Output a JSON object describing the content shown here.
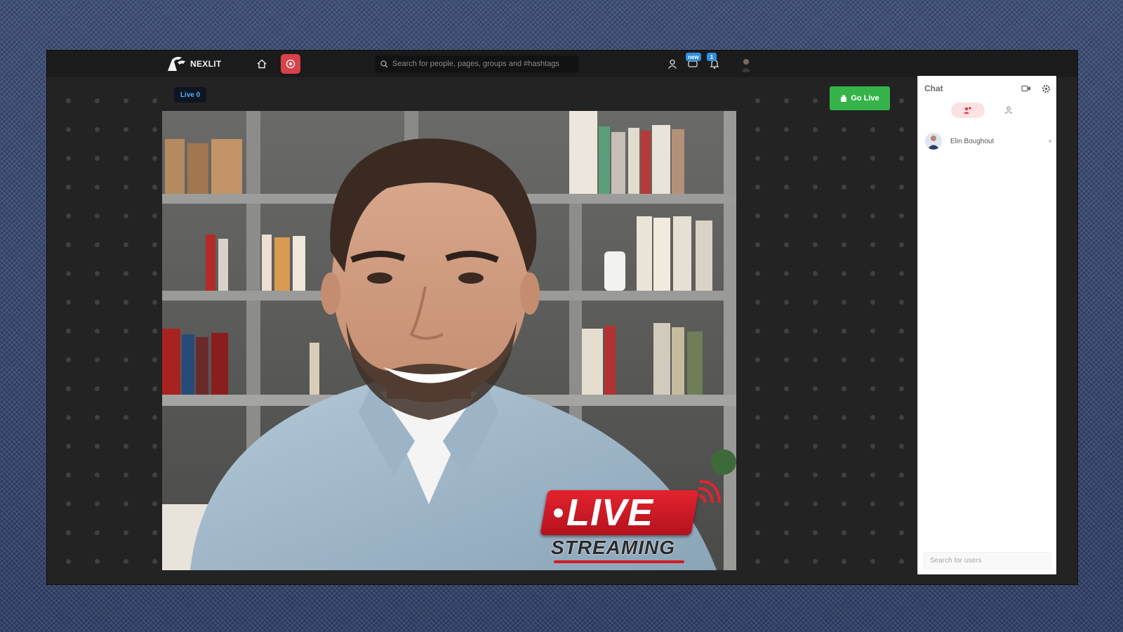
{
  "navbar": {
    "logo_text": "NEXLIT",
    "search_placeholder": "Search for people, pages, groups and #hashtags",
    "messages_badge": "new",
    "notifications_badge": "1"
  },
  "stream": {
    "tab_label": "Live 0",
    "go_live_label": "Go Live",
    "overlay_live": "LIVE",
    "overlay_streaming": "STREAMING"
  },
  "chat": {
    "title": "Chat",
    "users": [
      {
        "name": "Elin Boughout"
      }
    ],
    "search_placeholder": "Search for users"
  },
  "colors": {
    "go_live": "#36b44a",
    "live_red": "#d9414b",
    "badge_blue": "#2f8fe0",
    "tab_text": "#4fb0ff"
  },
  "icons": {
    "home": "home-icon",
    "live": "live-broadcast-icon",
    "search": "search-icon",
    "profile": "user-icon",
    "messages": "chat-bubbles-icon",
    "notifications": "bell-icon",
    "chat_video": "video-camera-icon",
    "chat_settings": "gear-icon",
    "chat_users_tab": "users-icon",
    "chat_groups_tab": "group-icon"
  }
}
